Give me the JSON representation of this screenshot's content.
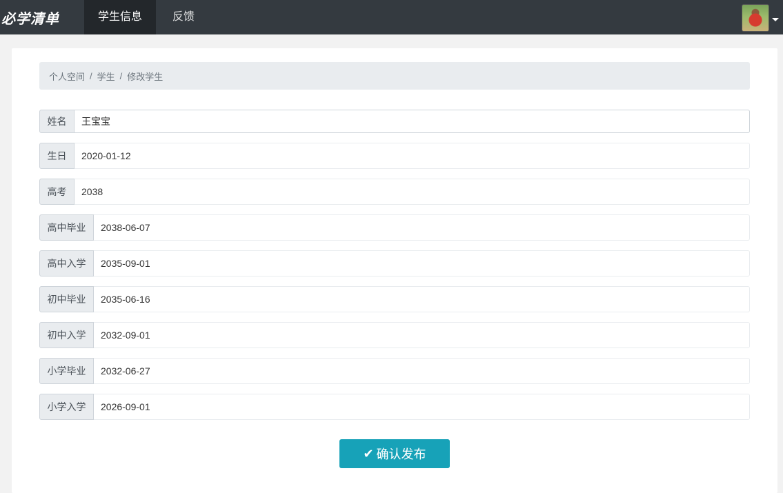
{
  "nav": {
    "brand": "必学清单",
    "items": [
      {
        "label": "学生信息"
      },
      {
        "label": "反馈"
      }
    ]
  },
  "breadcrumb": {
    "items": [
      "个人空间",
      "学生",
      "修改学生"
    ]
  },
  "form": {
    "fields": [
      {
        "label": "姓名",
        "value": "王宝宝"
      },
      {
        "label": "生日",
        "value": "2020-01-12"
      },
      {
        "label": "高考",
        "value": "2038"
      },
      {
        "label": "高中毕业",
        "value": "2038-06-07"
      },
      {
        "label": "高中入学",
        "value": "2035-09-01"
      },
      {
        "label": "初中毕业",
        "value": "2035-06-16"
      },
      {
        "label": "初中入学",
        "value": "2032-09-01"
      },
      {
        "label": "小学毕业",
        "value": "2032-06-27"
      },
      {
        "label": "小学入学",
        "value": "2026-09-01"
      }
    ],
    "submit_label": "确认发布",
    "submit_icon": "check-icon"
  },
  "colors": {
    "navbar": "#343a40",
    "nav_active": "#23272b",
    "accent": "#17a2b8",
    "breadcrumb_bg": "#e9ecef"
  }
}
